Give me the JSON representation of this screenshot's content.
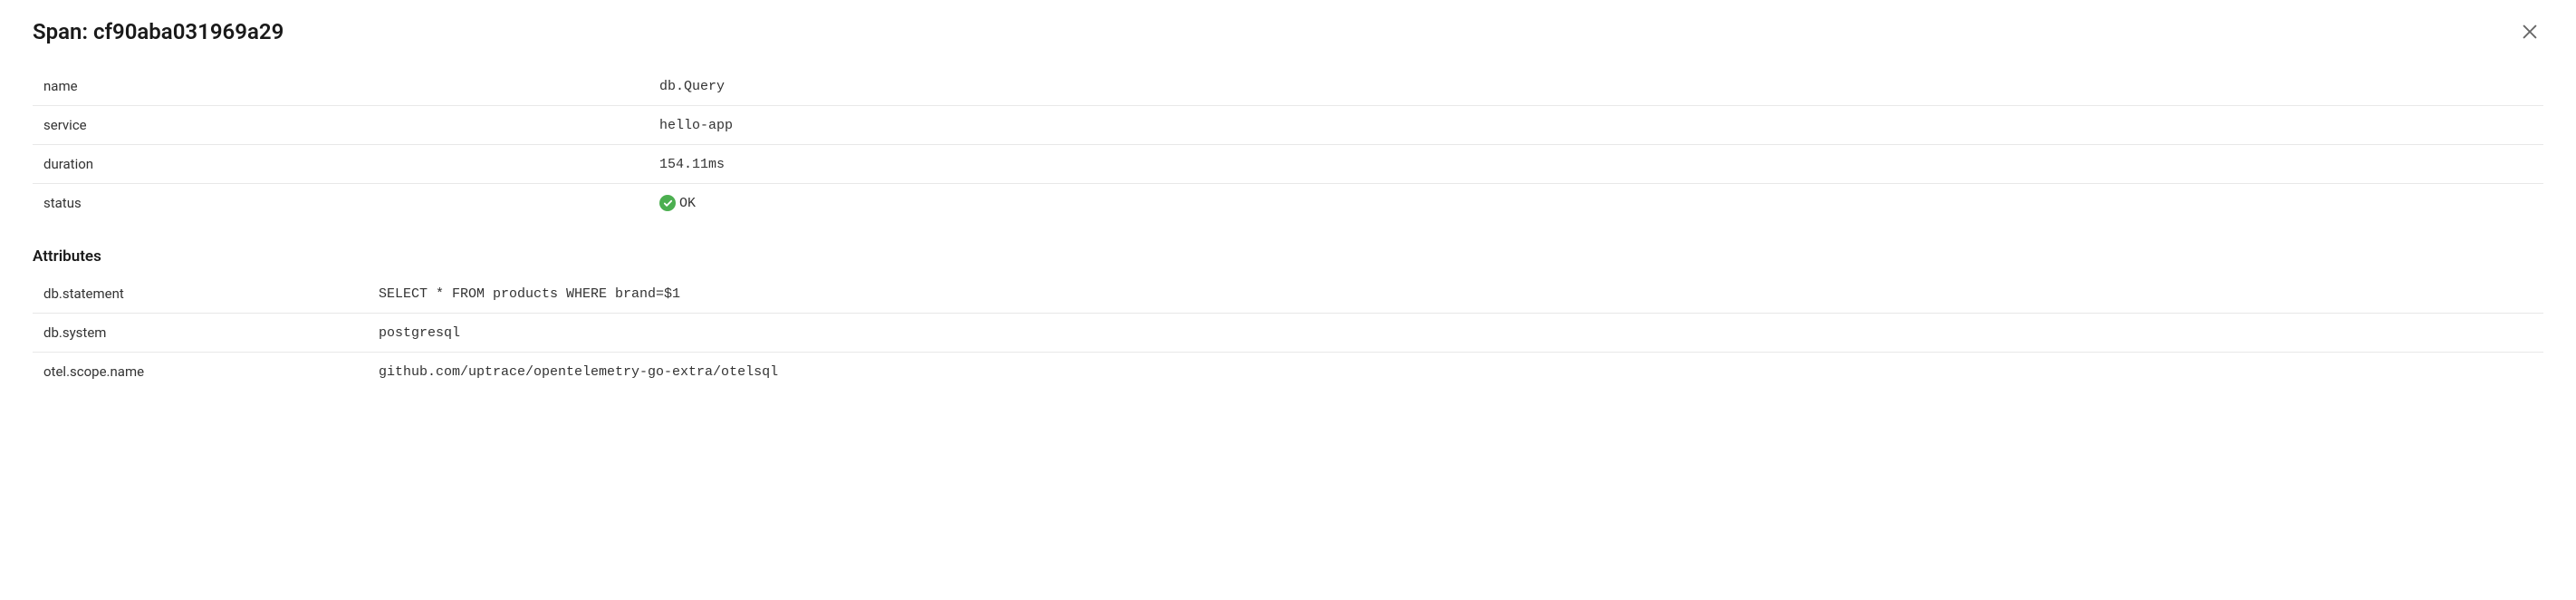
{
  "header": {
    "title": "Span: cf90aba031969a29"
  },
  "summary": {
    "rows": [
      {
        "key": "name",
        "value": "db.Query"
      },
      {
        "key": "service",
        "value": "hello-app"
      },
      {
        "key": "duration",
        "value": "154.11ms"
      },
      {
        "key": "status",
        "value": "OK",
        "status_ok": true
      }
    ]
  },
  "attributes": {
    "title": "Attributes",
    "rows": [
      {
        "key": "db.statement",
        "value": "SELECT * FROM products WHERE brand=$1"
      },
      {
        "key": "db.system",
        "value": "postgresql"
      },
      {
        "key": "otel.scope.name",
        "value": "github.com/uptrace/opentelemetry-go-extra/otelsql"
      }
    ]
  }
}
